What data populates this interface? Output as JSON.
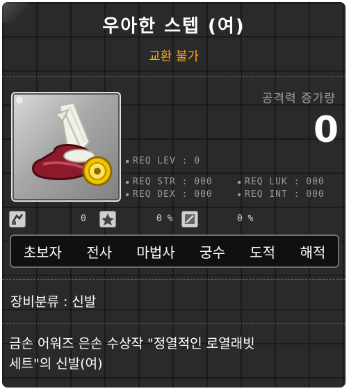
{
  "tooltip": {
    "title": "우아한 스텝 (여)",
    "subtitle": "교환 불가",
    "attack": {
      "label": "공격력 증가량",
      "value": "0"
    },
    "requirements": {
      "lev": "REQ LEV :    0",
      "str": "REQ STR : 000",
      "dex": "REQ DEX : 000",
      "luk": "REQ LUK : 000",
      "int": "REQ INT : 000"
    },
    "stat_icons": [
      {
        "name": "upgrade-icon",
        "value": "0"
      },
      {
        "name": "star-force-icon",
        "value": "0 %"
      },
      {
        "name": "potential-icon",
        "value": "0 %"
      }
    ],
    "jobs": [
      "초보자",
      "전사",
      "마법사",
      "궁수",
      "도적",
      "해적"
    ],
    "category": "장비분류 : 신발",
    "description": "금손 어워즈 은손 수상작 \"정열적인 로열래빗\n세트\"의 신발(여)"
  },
  "colors": {
    "title": "#ffffff",
    "subtitle": "#f5a623",
    "background": "#2a2a2a"
  }
}
